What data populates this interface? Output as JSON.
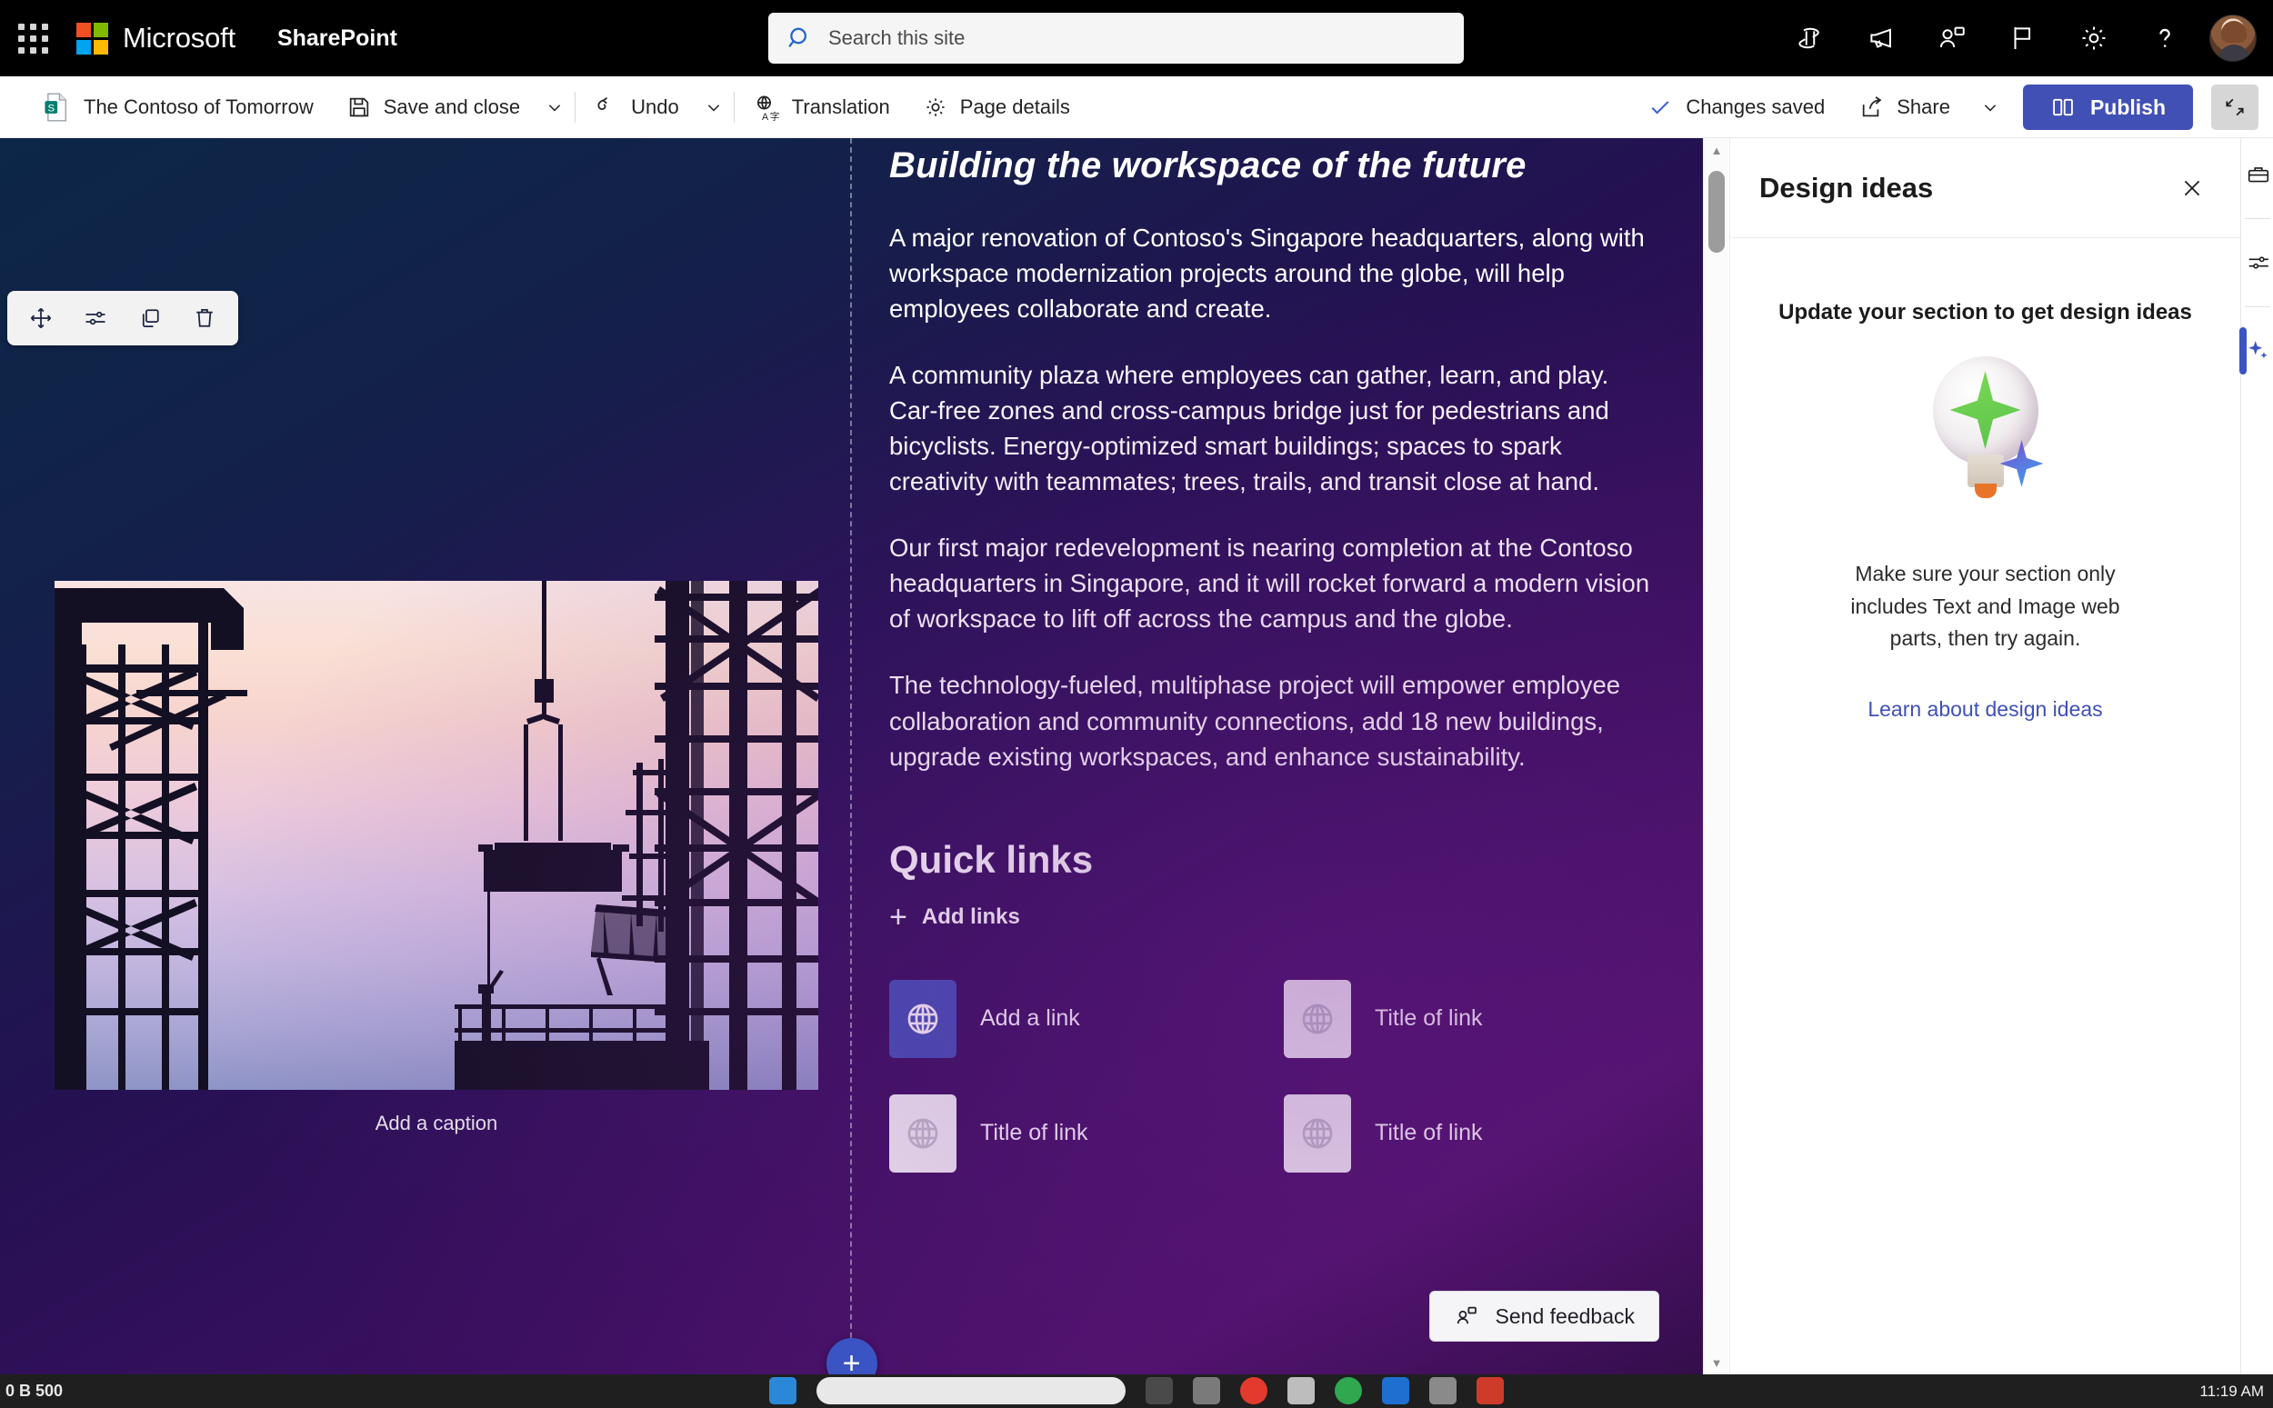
{
  "suite": {
    "waffle_label": "app-launcher",
    "brand": "Microsoft",
    "app_name": "SharePoint",
    "search_placeholder": "Search this site",
    "search_value": "",
    "icons": [
      "copilot-icon",
      "megaphone-icon",
      "meet-now-icon",
      "flag-icon",
      "gear-icon",
      "help-icon"
    ],
    "avatar_label": "user-avatar"
  },
  "command_bar": {
    "page_title": "The Contoso of Tomorrow",
    "save_and_close": "Save and close",
    "undo": "Undo",
    "translation": "Translation",
    "page_details": "Page details",
    "changes_saved": "Changes saved",
    "share": "Share",
    "publish": "Publish",
    "collapse_label": "collapse-ribbon"
  },
  "webpart_toolbar": {
    "move": "move-web-part",
    "edit": "edit-web-part",
    "duplicate": "duplicate-web-part",
    "delete": "delete-web-part"
  },
  "image_webpart": {
    "caption_placeholder": "Add a caption",
    "alt": "construction-site-silhouette-at-dusk"
  },
  "text_webpart": {
    "title": "Building the workspace of the future",
    "paragraphs": [
      "A major renovation of Contoso's Singapore headquarters, along with workspace modernization projects around the globe, will help employees collaborate and create.",
      "A community plaza where employees can gather, learn, and play. Car-free zones and cross-campus bridge just for pedestrians and bicyclists. Energy-optimized smart buildings; spaces to spark creativity with teammates; trees, trails, and transit close at hand.",
      "Our first major redevelopment is nearing completion at the Contoso headquarters in Singapore, and it will rocket forward a modern vision of workspace to lift off across the campus and the globe.",
      "The technology-fueled, multiphase project will empower employee collaboration and community connections, add 18 new buildings, upgrade existing workspaces, and enhance sustainability."
    ]
  },
  "quick_links": {
    "title": "Quick links",
    "add_links": "Add links",
    "items": [
      {
        "label": "Add a link",
        "icon": "globe-icon",
        "active": true
      },
      {
        "label": "Title of link",
        "icon": "globe-icon",
        "active": false
      },
      {
        "label": "Title of link",
        "icon": "globe-icon",
        "active": false
      },
      {
        "label": "Title of link",
        "icon": "globe-icon",
        "active": false
      }
    ]
  },
  "canvas_actions": {
    "send_feedback": "Send feedback",
    "add_section": "+"
  },
  "design_ideas": {
    "title": "Design ideas",
    "close_label": "close-panel",
    "subtitle": "Update your section to get design ideas",
    "message": "Make sure your section only includes Text and Image web parts, then try again.",
    "link": "Learn about design ideas"
  },
  "rail": {
    "toolbox": "toolbox-icon",
    "properties": "properties-icon",
    "design_ideas": "design-ideas-sparkle-icon"
  },
  "taskbar": {
    "left_text": "0 B 500",
    "clock": "11:19 AM"
  },
  "colors": {
    "accent": "#4150b4",
    "link": "#4050b5",
    "header_bg": "#000000",
    "panel_bg": "#ffffff"
  }
}
